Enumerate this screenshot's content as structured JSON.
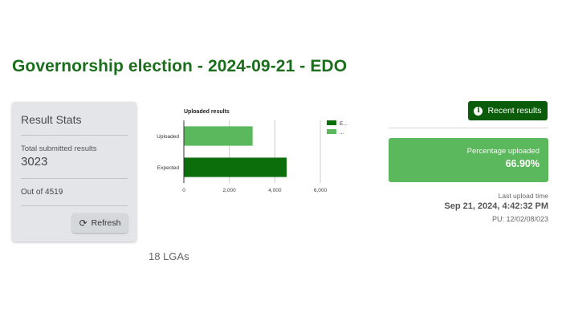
{
  "page": {
    "title": "Governorship election - 2024-09-21 - EDO"
  },
  "stats": {
    "title": "Result Stats",
    "submitted_label": "Total submitted results",
    "submitted_value": "3023",
    "out_of": "Out of 4519",
    "refresh_label": "Refresh",
    "refresh_icon": "refresh-icon"
  },
  "lgas_text": "18 LGAs",
  "recent": {
    "label": "Recent results",
    "icon": "info-icon"
  },
  "percentage": {
    "label": "Percentage uploaded",
    "value": "66.90%"
  },
  "upload": {
    "label": "Last upload time",
    "time": "Sep 21, 2024, 4:42:32 PM",
    "pu": "PU: 12/02/08/023"
  },
  "colors": {
    "title_green": "#1b6e1b",
    "button_dark_green": "#0a5c0a",
    "percentage_green": "#5cb85c",
    "expected_bar": "#0b6e0b",
    "uploaded_bar": "#5cb85c"
  },
  "chart_data": {
    "type": "bar",
    "orientation": "horizontal",
    "title": "Uploaded results",
    "categories": [
      "Uploaded",
      "Expected"
    ],
    "values": [
      3023,
      4519
    ],
    "bar_colors": [
      "#5cb85c",
      "#0b6e0b"
    ],
    "xlim": [
      0,
      6000
    ],
    "xticks": [
      "0",
      "2,000",
      "4,000",
      "6,000"
    ],
    "legend": [
      "E...",
      "..."
    ],
    "legend_colors": [
      "#0b6e0b",
      "#5cb85c"
    ],
    "legend_position": "right",
    "grid": true
  }
}
